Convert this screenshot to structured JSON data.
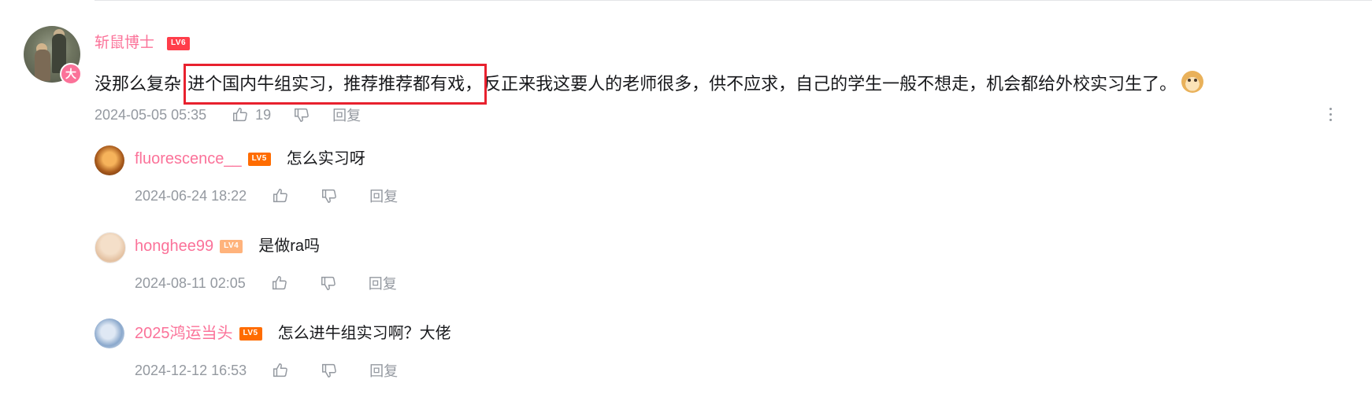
{
  "main_comment": {
    "username": "斩鼠博士",
    "level": "LV6",
    "vip_badge": "大",
    "text_before": "没那么复杂 ",
    "text_highlight": "进个国内牛组实习，推荐推荐都有戏，",
    "text_after": "反正来我这要人的老师很多，供不应求，自己的学生一般不想走，机会都给外校实习生了。",
    "timestamp": "2024-05-05 05:35",
    "likes": "19",
    "reply_label": "回复"
  },
  "replies": [
    {
      "username": "fluorescence__",
      "level": "LV5",
      "text": "怎么实习呀",
      "timestamp": "2024-06-24 18:22",
      "reply_label": "回复"
    },
    {
      "username": "honghee99",
      "level": "LV4",
      "text": "是做ra吗",
      "timestamp": "2024-08-11 02:05",
      "reply_label": "回复"
    },
    {
      "username": "2025鸿运当头",
      "level": "LV5",
      "text": "怎么进牛组实习啊？大佬",
      "timestamp": "2024-12-12 16:53",
      "reply_label": "回复"
    }
  ],
  "colors": {
    "username": "#fb7299",
    "meta_text": "#9499a0",
    "highlight_box": "#e8212e"
  },
  "icons": [
    "thumb-up-icon",
    "thumb-down-icon",
    "more-vertical-icon",
    "doge-emoji-icon"
  ]
}
